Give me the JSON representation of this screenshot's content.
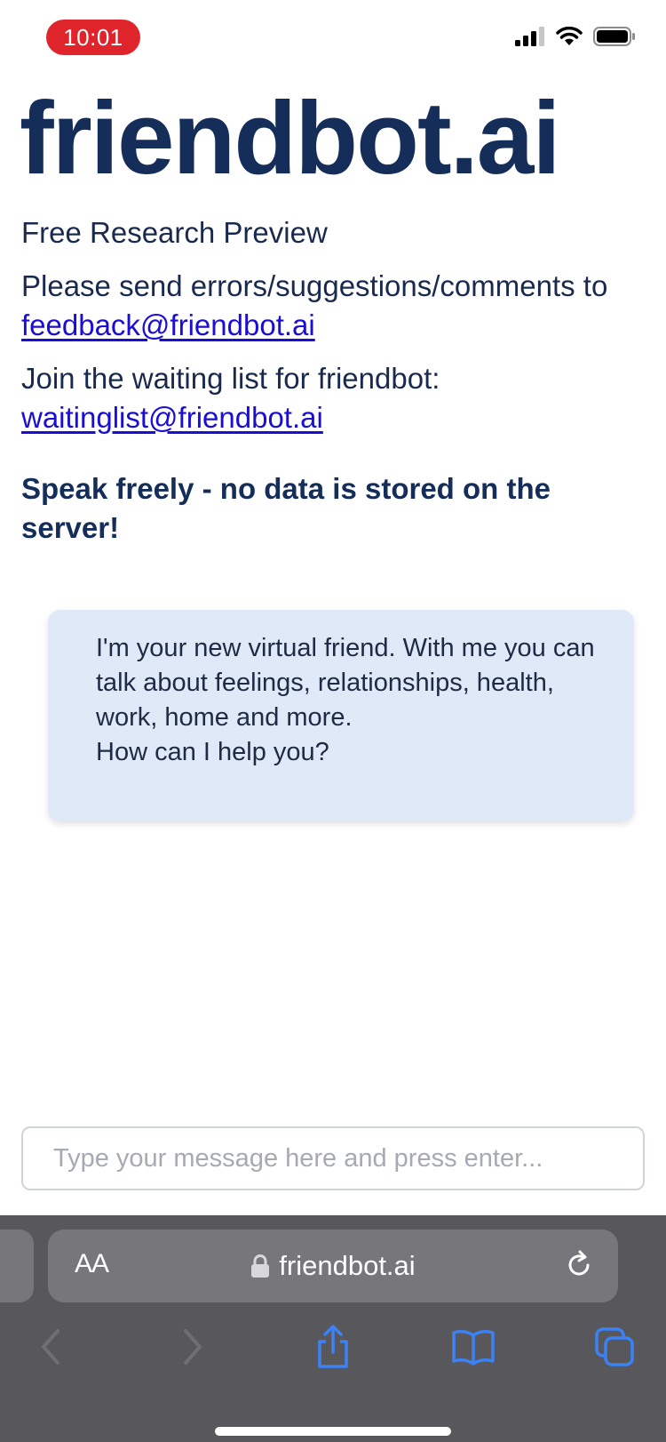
{
  "status_bar": {
    "time": "10:01",
    "time_pill_color": "#e0242c"
  },
  "page": {
    "brand": "friendbot.ai",
    "subtitle": "Free Research Preview",
    "feedback_text": "Please send errors/suggestions/comments to ",
    "feedback_email": "feedback@friendbot.ai",
    "waitlist_text": "Join the waiting list for friendbot:",
    "waitlist_email": "waitinglist@friendbot.ai",
    "notice": "Speak freely - no data is stored on the server!",
    "bot_message": "I'm your new virtual friend. With me you can talk about feelings, relationships, health, work, home and more.\nHow can I help you?"
  },
  "chat_input": {
    "placeholder": "Type your message here and press enter...",
    "value": ""
  },
  "browser": {
    "text_size_button": "AA",
    "url": "friendbot.ai",
    "icons": {
      "back": "chevron-left-icon",
      "forward": "chevron-right-icon",
      "share": "share-icon",
      "bookmarks": "book-icon",
      "tabs": "tabs-icon",
      "reload": "reload-icon",
      "lock": "lock-icon"
    }
  },
  "colors": {
    "brand": "#142d59",
    "link": "#1a0dd4",
    "bubble": "#dfe9f8",
    "toolbar": "#58585c",
    "accent_blue": "#3b82f6"
  }
}
